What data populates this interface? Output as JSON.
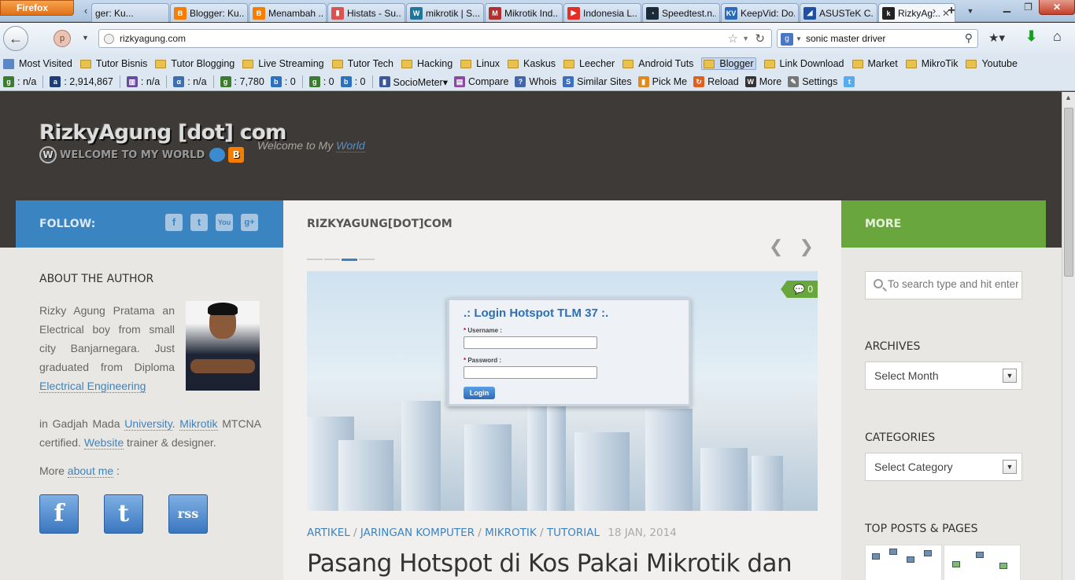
{
  "browser": {
    "firefox_label": "Firefox",
    "tabs": [
      {
        "label": "ger: Ku...",
        "color": "#888888",
        "icon": ""
      },
      {
        "label": "Blogger: Ku...",
        "color": "#f57d00",
        "icon": "B"
      },
      {
        "label": "Menambah ...",
        "color": "#f57d00",
        "icon": "B"
      },
      {
        "label": "Histats - Su...",
        "color": "#d9534f",
        "icon": "▮"
      },
      {
        "label": "mikrotik | S...",
        "color": "#21759b",
        "icon": "W"
      },
      {
        "label": "Mikrotik Ind...",
        "color": "#b03030",
        "icon": "M"
      },
      {
        "label": "Indonesia L...",
        "color": "#e52d27",
        "icon": "▶"
      },
      {
        "label": "Speedtest.n...",
        "color": "#1b2b3a",
        "icon": "◔"
      },
      {
        "label": "KeepVid: Do...",
        "color": "#2c6ab8",
        "icon": "KV"
      },
      {
        "label": "ASUSTeK C...",
        "color": "#1f4fa0",
        "icon": "◢"
      },
      {
        "label": "RizkyAg...",
        "color": "#222222",
        "icon": "k"
      }
    ],
    "url": "rizkyagung.com",
    "search_query": "sonic master driver",
    "search_engine_icon": "g",
    "bookmarks": [
      {
        "label": "Most Visited",
        "type": "special"
      },
      {
        "label": "Tutor Bisnis",
        "type": "folder"
      },
      {
        "label": "Tutor Blogging",
        "type": "folder"
      },
      {
        "label": "Live Streaming",
        "type": "folder"
      },
      {
        "label": "Tutor Tech",
        "type": "folder"
      },
      {
        "label": "Hacking",
        "type": "folder"
      },
      {
        "label": "Linux",
        "type": "folder"
      },
      {
        "label": "Kaskus",
        "type": "folder"
      },
      {
        "label": "Leecher",
        "type": "folder"
      },
      {
        "label": "Android Tuts",
        "type": "folder"
      },
      {
        "label": "Blogger",
        "type": "folder"
      },
      {
        "label": "Link Download",
        "type": "folder"
      },
      {
        "label": "Market",
        "type": "folder"
      },
      {
        "label": "MikroTik",
        "type": "folder"
      },
      {
        "label": "Youtube",
        "type": "folder"
      }
    ],
    "addon_items": [
      {
        "label": ": n/a",
        "icon": "g",
        "color": "#3a7d2c"
      },
      {
        "label": ": 2,914,867",
        "icon": "a",
        "color": "#1d3d7a"
      },
      {
        "label": ": n/a",
        "icon": "▥",
        "color": "#6a4aa0"
      },
      {
        "label": ": n/a",
        "icon": "α",
        "color": "#3d6fb0"
      },
      {
        "label": ": 7,780",
        "icon": "g",
        "color": "#3a7d2c"
      },
      {
        "label": ": 0",
        "icon": "b",
        "color": "#2a72c0"
      },
      {
        "label": ": 0",
        "icon": "g",
        "color": "#3a7d2c"
      },
      {
        "label": ": 0",
        "icon": "b",
        "color": "#2a72c0"
      },
      {
        "label": "SocioMeter▾",
        "icon": "▮",
        "color": "#3b5998"
      },
      {
        "label": "Compare",
        "icon": "▤",
        "color": "#8a4aa0"
      },
      {
        "label": "Whois",
        "icon": "?",
        "color": "#4466aa"
      },
      {
        "label": "Similar Sites",
        "icon": "S",
        "color": "#3b6fc0"
      },
      {
        "label": "Pick Me",
        "icon": "▮",
        "color": "#e08a1e"
      },
      {
        "label": "Reload",
        "icon": "↻",
        "color": "#e06020"
      },
      {
        "label": "More",
        "icon": "W",
        "color": "#333333"
      },
      {
        "label": "Settings",
        "icon": "✎",
        "color": "#777777"
      }
    ]
  },
  "site": {
    "logo_line1": "RizkyAgung [dot] com",
    "logo_line2": "WELCOME TO MY WORLD",
    "tagline_prefix": "Welcome to My ",
    "tagline_link": "World"
  },
  "left": {
    "follow_label": "FOLLOW:",
    "social_icons": [
      "f",
      "t",
      "You",
      "g+"
    ],
    "about_heading": "ABOUT THE AUTHOR",
    "about_p1": "Rizky Agung Pratama an Electrical boy from small city Banjarnegara. Just graduated from Diploma",
    "about_link1": "Electrical Engineering",
    "about_p2": " in Gadjah Mada ",
    "about_link2": "University",
    "about_p3": ".",
    "about_link3": "Mikrotik",
    "about_p4": " MTCNA certified. ",
    "about_link4": "Website",
    "about_p5": " trainer & designer.",
    "more_prefix": "More ",
    "more_link": "about me",
    "more_suffix": " :",
    "big_icons": [
      "f",
      "t",
      "rss"
    ]
  },
  "center": {
    "title": "RIZKYAGUNG[DOT]COM",
    "prev": "❮",
    "next": "❯",
    "login_title": ".: Login Hotspot TLM 37 :.",
    "username_label": "Username :",
    "password_label": "Password :",
    "login_button": "Login",
    "comment_count": "0",
    "categories": [
      "ARTIKEL",
      "JARINGAN KOMPUTER",
      "MIKROTIK",
      "TUTORIAL"
    ],
    "date": "18 JAN, 2014",
    "post_title": "Pasang Hotspot di Kos Pakai Mikrotik dan"
  },
  "right": {
    "more_label": "MORE",
    "search_placeholder": "To search type and hit enter",
    "archives_heading": "ARCHIVES",
    "archives_select": "Select Month",
    "categories_heading": "CATEGORIES",
    "categories_select": "Select Category",
    "top_posts_heading": "TOP POSTS & PAGES"
  }
}
